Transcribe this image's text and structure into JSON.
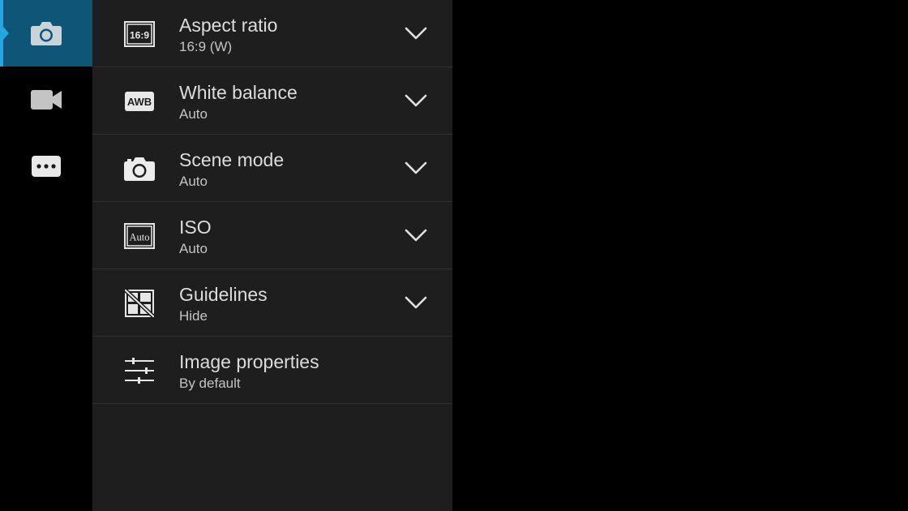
{
  "rail": {
    "items": [
      {
        "name": "photo-mode",
        "icon": "camera-icon",
        "active": true
      },
      {
        "name": "video-mode",
        "icon": "video-camera-icon",
        "active": false
      },
      {
        "name": "more-mode",
        "icon": "more-dots-icon",
        "active": false
      }
    ],
    "accent": "#22a7e0",
    "active_bg": "#0e5577"
  },
  "settings": {
    "rows": [
      {
        "title": "Aspect ratio",
        "value": "16:9 (W)",
        "icon": "aspect-ratio-icon",
        "icon_text": "16:9",
        "has_dropdown": true
      },
      {
        "title": "White balance",
        "value": "Auto",
        "icon": "awb-icon",
        "icon_text": "AWB",
        "has_dropdown": true
      },
      {
        "title": "Scene mode",
        "value": "Auto",
        "icon": "scene-camera-icon",
        "has_dropdown": true
      },
      {
        "title": "ISO",
        "value": "Auto",
        "icon": "iso-auto-icon",
        "icon_text": "Auto",
        "has_dropdown": true
      },
      {
        "title": "Guidelines",
        "value": "Hide",
        "icon": "guidelines-hidden-icon",
        "has_dropdown": true
      },
      {
        "title": "Image properties",
        "value": "By default",
        "icon": "sliders-icon",
        "has_dropdown": false
      }
    ]
  }
}
